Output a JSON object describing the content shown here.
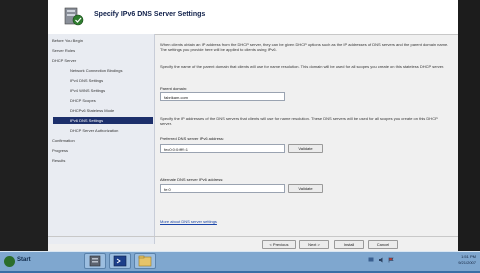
{
  "wizard": {
    "title": "Specify IPv6 DNS Server Settings"
  },
  "nav": {
    "items": [
      {
        "label": "Before You Begin"
      },
      {
        "label": "Server Roles"
      },
      {
        "label": "DHCP Server"
      },
      {
        "label": "Network Connection Bindings"
      },
      {
        "label": "IPv4 DNS Settings"
      },
      {
        "label": "IPv4 WINS Settings"
      },
      {
        "label": "DHCP Scopes"
      },
      {
        "label": "DHCPv6 Stateless Mode"
      },
      {
        "label": "IPv6 DNS Settings"
      },
      {
        "label": "DHCP Server Authorization"
      },
      {
        "label": "Confirmation"
      },
      {
        "label": "Progress"
      },
      {
        "label": "Results"
      }
    ],
    "selected": "IPv6 DNS Settings"
  },
  "content": {
    "intro": "When clients obtain an IP address from the DHCP server, they can be given DHCP options such as the IP addresses of DNS servers and the parent domain name. The settings you provide here will be applied to clients using IPv6.",
    "domain_desc": "Specify the name of the parent domain that clients will use for name resolution. This domain will be used for all scopes you create on this stateless DHCP server.",
    "parent_domain_label": "Parent domain:",
    "parent_domain_value": "fabrikam.com",
    "dns_desc": "Specify the IP addresses of the DNS servers that clients will use for name resolution. These DNS servers will be used for all scopes you create on this DHCP server.",
    "preferred_label": "Preferred DNS server IPv6 address:",
    "preferred_value": "fec0:0:0:ffff::1",
    "validate_label": "Validate",
    "alternate_label": "Alternate DNS server IPv6 address:",
    "alternate_value": "fe:0",
    "validate2_label": "Validate",
    "more_link": "More about DNS server settings"
  },
  "footer": {
    "previous_label": "< Previous",
    "next_label": "Next >",
    "install_label": "Install",
    "cancel_label": "Cancel"
  },
  "taskbar": {
    "start_label": "Start",
    "time": "1:51 PM",
    "date": "9/21/2007"
  },
  "colors": {
    "selected_nav": "#1c2f6b",
    "desktop": "#3a6ea5",
    "taskbar": "#7fa7cf"
  },
  "icons": [
    "wizard-server-icon",
    "start-orb-icon",
    "server-manager-icon",
    "powershell-icon",
    "explorer-icon",
    "network-icon",
    "speaker-icon",
    "flag-icon"
  ]
}
